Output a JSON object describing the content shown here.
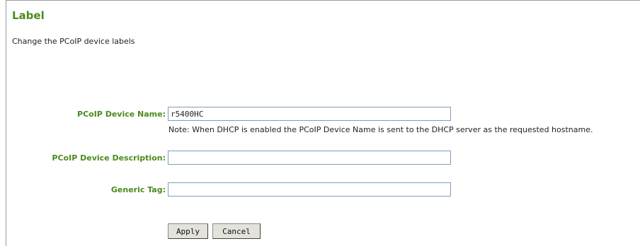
{
  "header": {
    "title": "Label",
    "subtitle": "Change the PCoIP device labels"
  },
  "form": {
    "device_name": {
      "label": "PCoIP Device Name:",
      "value": "r5400HC",
      "note": "Note: When DHCP is enabled the PCoIP Device Name is sent to the DHCP server as the requested hostname."
    },
    "device_description": {
      "label": "PCoIP Device Description:",
      "value": ""
    },
    "generic_tag": {
      "label": "Generic Tag:",
      "value": ""
    }
  },
  "actions": {
    "apply_label": "Apply",
    "cancel_label": "Cancel"
  }
}
